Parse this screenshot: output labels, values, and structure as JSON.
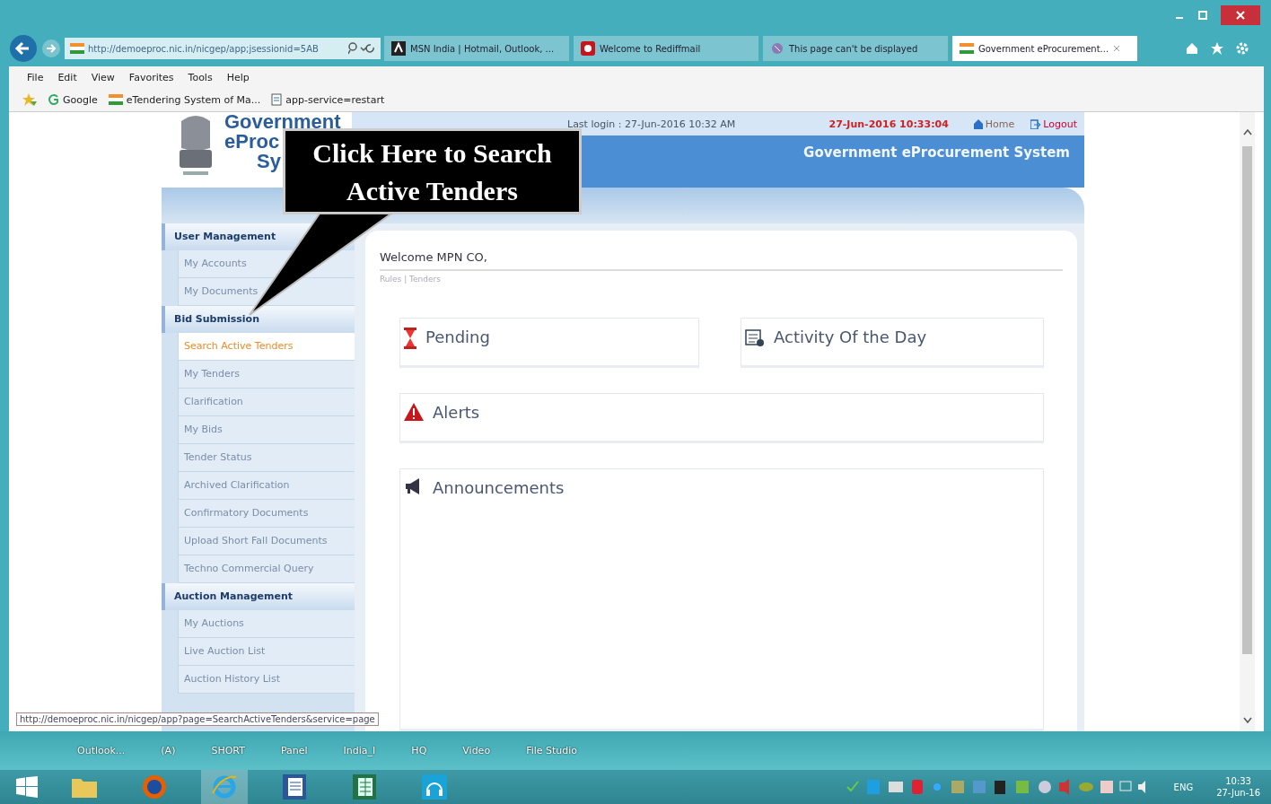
{
  "browser": {
    "address": "http://demoeproc.nic.in/nicgep/app;jsessionid=5AB",
    "tabs": [
      {
        "label": "MSN India | Hotmail, Outlook, ...",
        "selected": false
      },
      {
        "label": "Welcome to Rediffmail",
        "selected": false
      },
      {
        "label": "This page can't be displayed",
        "selected": false
      },
      {
        "label": "Government eProcurement...",
        "selected": true
      }
    ],
    "menu": [
      "File",
      "Edit",
      "View",
      "Favorites",
      "Tools",
      "Help"
    ],
    "favorites": [
      "Google",
      "eTendering System of Ma...",
      "app-service=restart"
    ]
  },
  "page": {
    "header": {
      "logo_lines": [
        "Government",
        "eProc",
        "Sy"
      ],
      "last_login": "Last login : 27-Jun-2016 10:32 AM",
      "server_time": "27-Jun-2016 10:33:04",
      "links": [
        "Home",
        "Logout"
      ],
      "banner": "Government eProcurement System"
    },
    "callout": "Click Here to Search Active Tenders",
    "sidebar": [
      {
        "title": "User Management",
        "items": [
          {
            "label": "My Accounts",
            "selected": false
          },
          {
            "label": "My Documents",
            "selected": false
          }
        ]
      },
      {
        "title": "Bid Submission",
        "items": [
          {
            "label": "Search Active Tenders",
            "selected": true
          },
          {
            "label": "My Tenders",
            "selected": false
          },
          {
            "label": "Clarification",
            "selected": false
          },
          {
            "label": "My Bids",
            "selected": false
          },
          {
            "label": "Tender Status",
            "selected": false
          },
          {
            "label": "Archived Clarification",
            "selected": false
          },
          {
            "label": "Confirmatory Documents",
            "selected": false
          },
          {
            "label": "Upload Short Fall Documents",
            "selected": false
          },
          {
            "label": "Techno Commercial Query",
            "selected": false
          }
        ]
      },
      {
        "title": "Auction Management",
        "items": [
          {
            "label": "My Auctions",
            "selected": false
          },
          {
            "label": "Live Auction List",
            "selected": false
          },
          {
            "label": "Auction History List",
            "selected": false
          }
        ]
      }
    ],
    "welcome": "Welcome MPN CO,",
    "breadcrumb": "Rules | Tenders",
    "panels": [
      {
        "title": "Pending",
        "kind": "pending"
      },
      {
        "title": "Activity Of the Day",
        "kind": "activity"
      },
      {
        "title": "Alerts",
        "kind": "alerts"
      },
      {
        "title": "Announcements",
        "kind": "announcements"
      }
    ]
  },
  "status_url": "http://demoeproc.nic.in/nicgep/app?page=SearchActiveTenders&service=page",
  "desktop_icons": [
    "Outlook...",
    "(A)",
    "SHORT",
    "Panel",
    "India_I",
    "HQ",
    "Video",
    "File Studio"
  ],
  "taskbar": {
    "apps": [
      {
        "kind": "folder",
        "selected": false
      },
      {
        "kind": "firefox",
        "selected": false
      },
      {
        "kind": "ie",
        "selected": true
      },
      {
        "kind": "word",
        "selected": false
      },
      {
        "kind": "excel",
        "selected": false
      },
      {
        "kind": "music",
        "selected": false
      }
    ],
    "language": "ENG",
    "time": "10:33",
    "date": "27-Jun-16"
  }
}
